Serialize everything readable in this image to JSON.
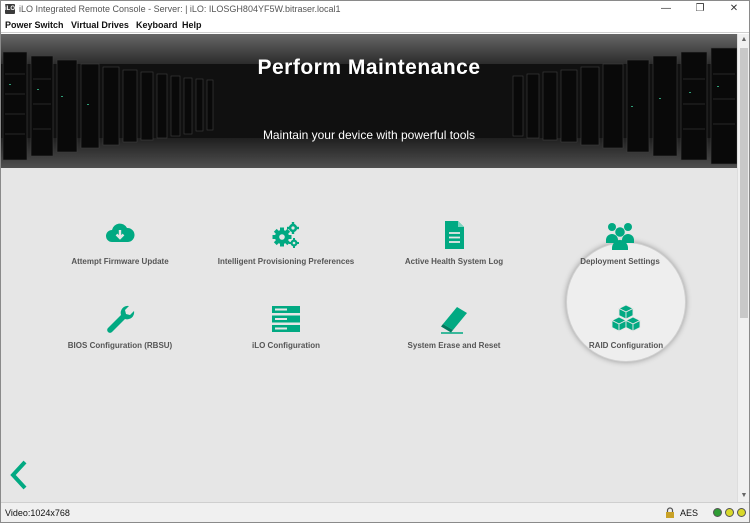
{
  "window": {
    "app_icon": "iLO",
    "title": "iLO Integrated Remote Console - Server: | iLO: ILOSGH804YF5W.bitraser.local1",
    "controls": {
      "minimize": "—",
      "restore": "❐",
      "close": "✕"
    }
  },
  "menu": [
    "Power Switch",
    "Virtual Drives",
    "Keyboard",
    "Help"
  ],
  "hero": {
    "title": "Perform Maintenance",
    "subtitle": "Maintain your device with powerful tools"
  },
  "tiles": [
    {
      "label": "Attempt Firmware Update",
      "icon": "cloud-download-icon"
    },
    {
      "label": "Intelligent Provisioning Preferences",
      "icon": "gears-icon"
    },
    {
      "label": "Active Health System Log",
      "icon": "document-icon"
    },
    {
      "label": "Deployment Settings",
      "icon": "users-icon"
    },
    {
      "label": "BIOS Configuration (RBSU)",
      "icon": "wrench-icon"
    },
    {
      "label": "iLO Configuration",
      "icon": "server-stack-icon"
    },
    {
      "label": "System Erase and Reset",
      "icon": "eraser-icon"
    },
    {
      "label": "RAID Configuration",
      "icon": "cubes-icon"
    }
  ],
  "navigation": {
    "back": "back-arrow-icon"
  },
  "status": {
    "video": "Video:1024x768",
    "encryption": "AES",
    "leds": [
      "#2e9c34",
      "#d8d82a",
      "#d8d82a"
    ]
  },
  "colors": {
    "accent": "#01a982",
    "content_bg": "#e6e6e6",
    "label": "#555555"
  }
}
